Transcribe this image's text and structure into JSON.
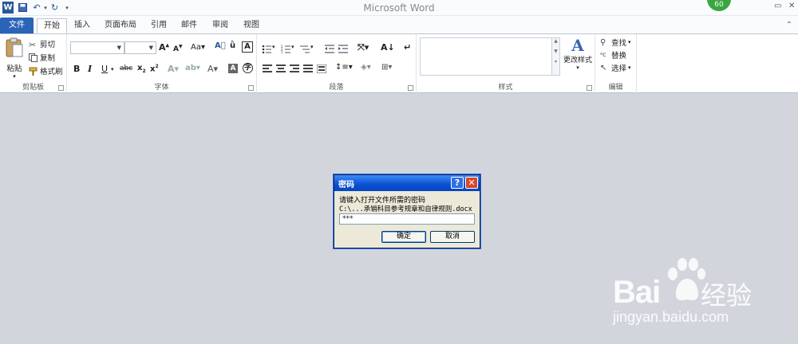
{
  "window": {
    "title": "Microsoft Word",
    "badge": "60"
  },
  "tabs": [
    "文件",
    "开始",
    "插入",
    "页面布局",
    "引用",
    "邮件",
    "审阅",
    "视图"
  ],
  "ribbon": {
    "clipboard": {
      "paste": "粘贴",
      "cut": "剪切",
      "copy": "复制",
      "format_painter": "格式刷",
      "label": "剪贴板"
    },
    "font": {
      "label": "字体"
    },
    "paragraph": {
      "label": "段落"
    },
    "styles": {
      "change_styles": "更改样式",
      "label": "样式"
    },
    "editing": {
      "find": "查找",
      "replace": "替换",
      "select": "选择",
      "label": "编辑"
    }
  },
  "dialog": {
    "title": "密码",
    "prompt": "请键入打开文件所需的密码",
    "path": "C:\\...承销科目参考规章和自律规则.docx",
    "password_value": "***",
    "ok": "确定",
    "cancel": "取消"
  },
  "watermark": {
    "brand_left": "Bai",
    "brand_right": "经验",
    "url": "jingyan.baidu.com"
  }
}
